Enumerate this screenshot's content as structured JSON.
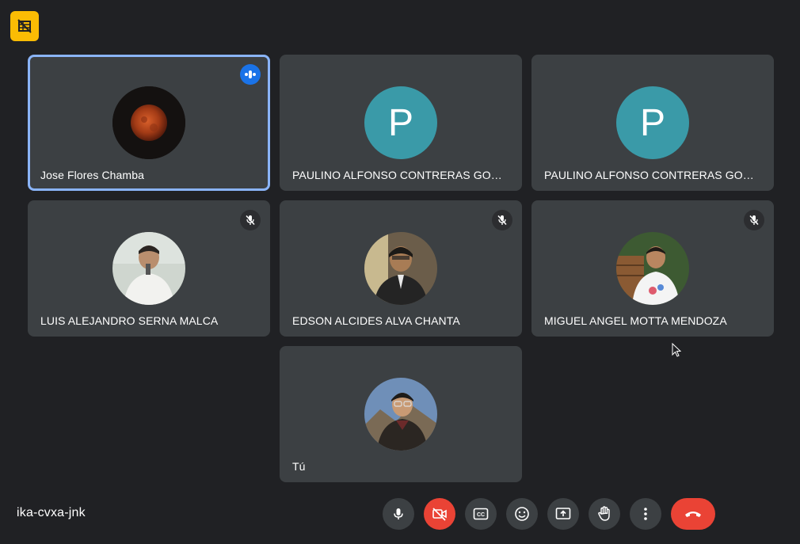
{
  "meeting": {
    "code": "ika-cvxa-jnk"
  },
  "participants": [
    {
      "name": "Jose Flores Chamba",
      "avatar": "photo-blood-moon",
      "status": "speaking",
      "active": true
    },
    {
      "name": "PAULINO ALFONSO CONTRERAS GOM...",
      "avatar_letter": "P",
      "status": "none"
    },
    {
      "name": "PAULINO ALFONSO CONTRERAS GOM...",
      "avatar_letter": "P",
      "status": "none"
    },
    {
      "name": "LUIS ALEJANDRO SERNA MALCA",
      "avatar": "photo-person-white-shirt",
      "status": "muted"
    },
    {
      "name": "EDSON ALCIDES ALVA CHANTA",
      "avatar": "photo-person-suit",
      "status": "muted"
    },
    {
      "name": "MIGUEL ANGEL MOTTA MENDOZA",
      "avatar": "photo-person-outdoor",
      "status": "muted"
    },
    {
      "name": "Tú",
      "avatar": "photo-person-mountain",
      "status": "none"
    }
  ],
  "controls": [
    "microphone-icon",
    "camera-off-icon",
    "captions-icon",
    "emoji-icon",
    "present-screen-icon",
    "raise-hand-icon",
    "more-options-icon",
    "end-call-icon"
  ],
  "colors": {
    "background": "#202124",
    "tile": "#3c4043",
    "active_border": "#8ab4f8",
    "end_call": "#ea4335",
    "badge": "#fbbc04",
    "letter_avatar": "#3a9aa8"
  }
}
